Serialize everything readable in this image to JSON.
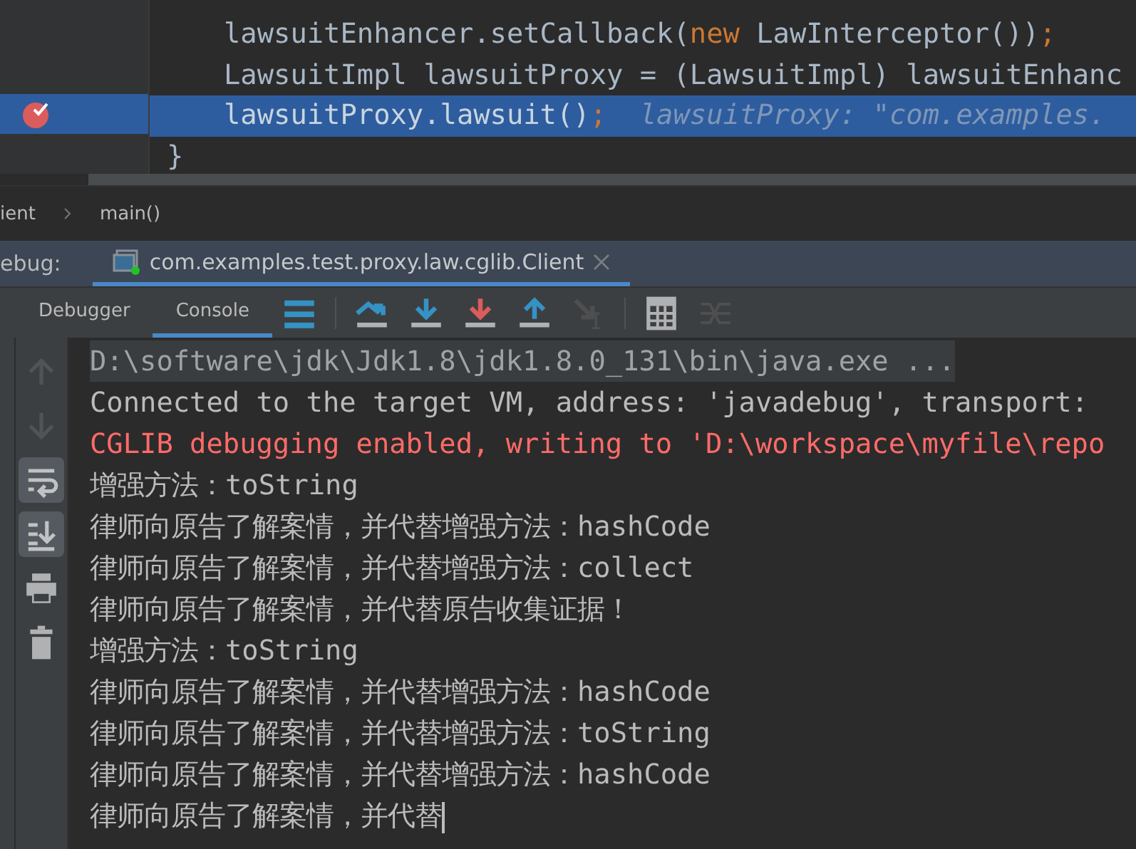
{
  "editor": {
    "lines": [
      {
        "selected": false,
        "breakpoint": false,
        "tokens": [
          {
            "kind": "plain",
            "text": "lawsuitEnhancer.setCallback("
          },
          {
            "kind": "keyword",
            "text": "new"
          },
          {
            "kind": "plain",
            "text": " LawInterceptor())"
          },
          {
            "kind": "keyword",
            "text": ";"
          }
        ]
      },
      {
        "selected": false,
        "breakpoint": false,
        "tokens": [
          {
            "kind": "plain",
            "text": "LawsuitImpl lawsuitProxy = (LawsuitImpl) lawsuitEnhanc"
          }
        ]
      },
      {
        "selected": true,
        "breakpoint": true,
        "tokens": [
          {
            "kind": "plain",
            "text": "lawsuitProxy.lawsuit()"
          },
          {
            "kind": "keyword",
            "text": ";"
          },
          {
            "kind": "hint",
            "text": "  lawsuitProxy: \"com.examples."
          }
        ]
      },
      {
        "selected": false,
        "breakpoint": false,
        "tokens": [
          {
            "kind": "brace",
            "text": "}"
          }
        ]
      }
    ]
  },
  "breadcrumb": [
    "ient",
    "main()"
  ],
  "debug_bar": {
    "label": "ebug:",
    "session": "com.examples.test.proxy.law.cglib.Client"
  },
  "tabs": [
    {
      "label": "Debugger",
      "selected": false
    },
    {
      "label": "Console",
      "selected": true
    }
  ],
  "toolbar": [
    {
      "kind": "menu",
      "disabled": false
    },
    {
      "kind": "sep"
    },
    {
      "kind": "step-over",
      "disabled": false
    },
    {
      "kind": "step-into",
      "disabled": false
    },
    {
      "kind": "force-step-into",
      "disabled": false
    },
    {
      "kind": "step-out",
      "disabled": false
    },
    {
      "kind": "run-to-cursor",
      "disabled": true
    },
    {
      "kind": "sep"
    },
    {
      "kind": "calculator",
      "disabled": false
    },
    {
      "kind": "trace",
      "disabled": true
    }
  ],
  "side_tools": [
    {
      "kind": "up",
      "on": false,
      "disabled": true
    },
    {
      "kind": "down",
      "on": false,
      "disabled": true
    },
    {
      "kind": "wrap",
      "on": true,
      "disabled": false
    },
    {
      "kind": "scroll-end",
      "on": true,
      "disabled": false
    },
    {
      "kind": "print",
      "on": false,
      "disabled": false
    },
    {
      "kind": "trash",
      "on": false,
      "disabled": false
    }
  ],
  "console": [
    {
      "kind": "command",
      "text": "D:\\software\\jdk\\Jdk1.8\\jdk1.8.0_131\\bin\\java.exe ..."
    },
    {
      "kind": "output",
      "text": "Connected to the target VM, address: 'javadebug', transport: "
    },
    {
      "kind": "error",
      "text": "CGLIB debugging enabled, writing to 'D:\\workspace\\myfile\\repo"
    },
    {
      "kind": "output",
      "text": "增强方法：toString"
    },
    {
      "kind": "output",
      "text": "律师向原告了解案情，并代替增强方法：hashCode"
    },
    {
      "kind": "output",
      "text": "律师向原告了解案情，并代替增强方法：collect"
    },
    {
      "kind": "output",
      "text": "律师向原告了解案情，并代替原告收集证据！"
    },
    {
      "kind": "output",
      "text": "增强方法：toString"
    },
    {
      "kind": "output",
      "text": "律师向原告了解案情，并代替增强方法：hashCode"
    },
    {
      "kind": "output",
      "text": "律师向原告了解案情，并代替增强方法：toString"
    },
    {
      "kind": "output",
      "text": "律师向原告了解案情，并代替增强方法：hashCode"
    },
    {
      "kind": "input",
      "text": "律师向原告了解案情，并代替"
    }
  ]
}
